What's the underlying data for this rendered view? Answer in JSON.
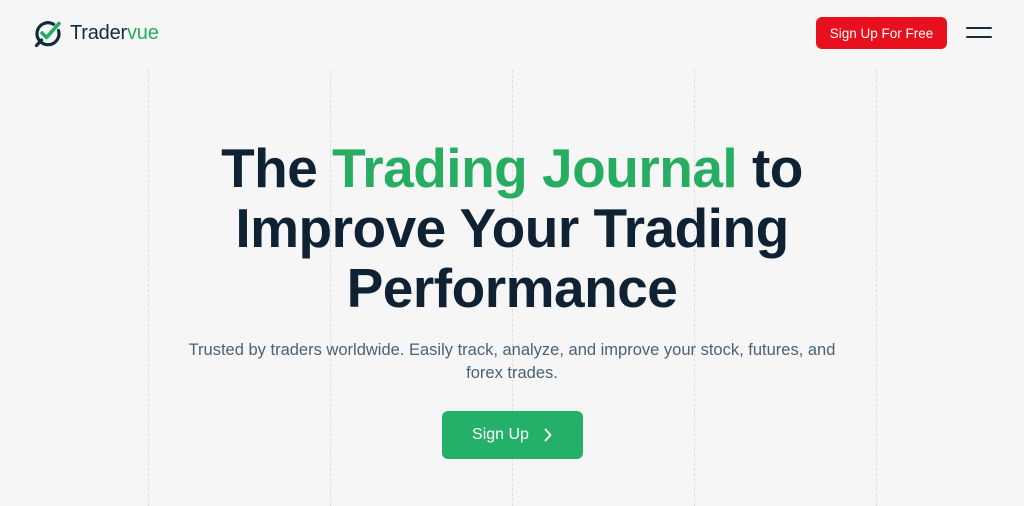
{
  "brand": {
    "name_part1": "Trader",
    "name_part2": "vue",
    "accent_color": "#27ad62",
    "primary_dark": "#0f2233"
  },
  "header": {
    "signup_free_label": "Sign Up For Free",
    "signup_free_color": "#e8101c",
    "menu_icon": "hamburger-menu-icon"
  },
  "hero": {
    "title_part1": "The ",
    "title_highlight": "Trading Journal",
    "title_part2": " to Improve Your Trading Performance",
    "subtitle": "Trusted by traders worldwide. Easily track, analyze, and improve your stock, futures, and forex trades.",
    "cta_label": "Sign Up",
    "cta_icon": "chevron-right-icon",
    "cta_color": "#25b06a"
  }
}
